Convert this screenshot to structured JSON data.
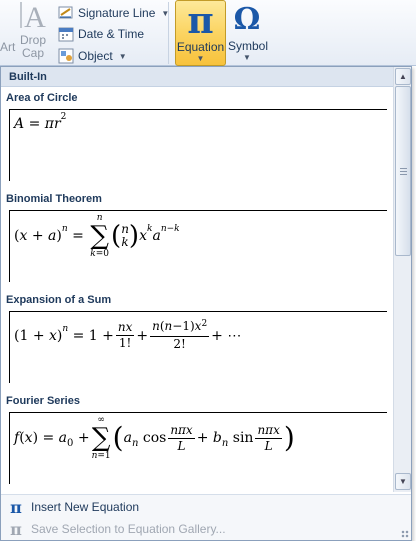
{
  "ribbon": {
    "art_label": "Art",
    "drop_cap_label_1": "Drop",
    "drop_cap_label_2": "Cap",
    "signature_line_label": "Signature Line",
    "date_time_label": "Date & Time",
    "object_label": "Object",
    "equation_label": "Equation",
    "symbol_label": "Symbol",
    "icons": {
      "equation": "pi-icon",
      "symbol": "omega-icon"
    },
    "colors": {
      "active_button": "#fbd462",
      "accent": "#1b58a8"
    }
  },
  "gallery": {
    "header": "Built-In",
    "sections": [
      {
        "title": "Area of Circle"
      },
      {
        "title": "Binomial Theorem"
      },
      {
        "title": "Expansion of a Sum"
      },
      {
        "title": "Fourier Series"
      }
    ]
  },
  "footer": {
    "insert_new": "Insert New Equation",
    "save_selection": "Save Selection to Equation Gallery..."
  }
}
